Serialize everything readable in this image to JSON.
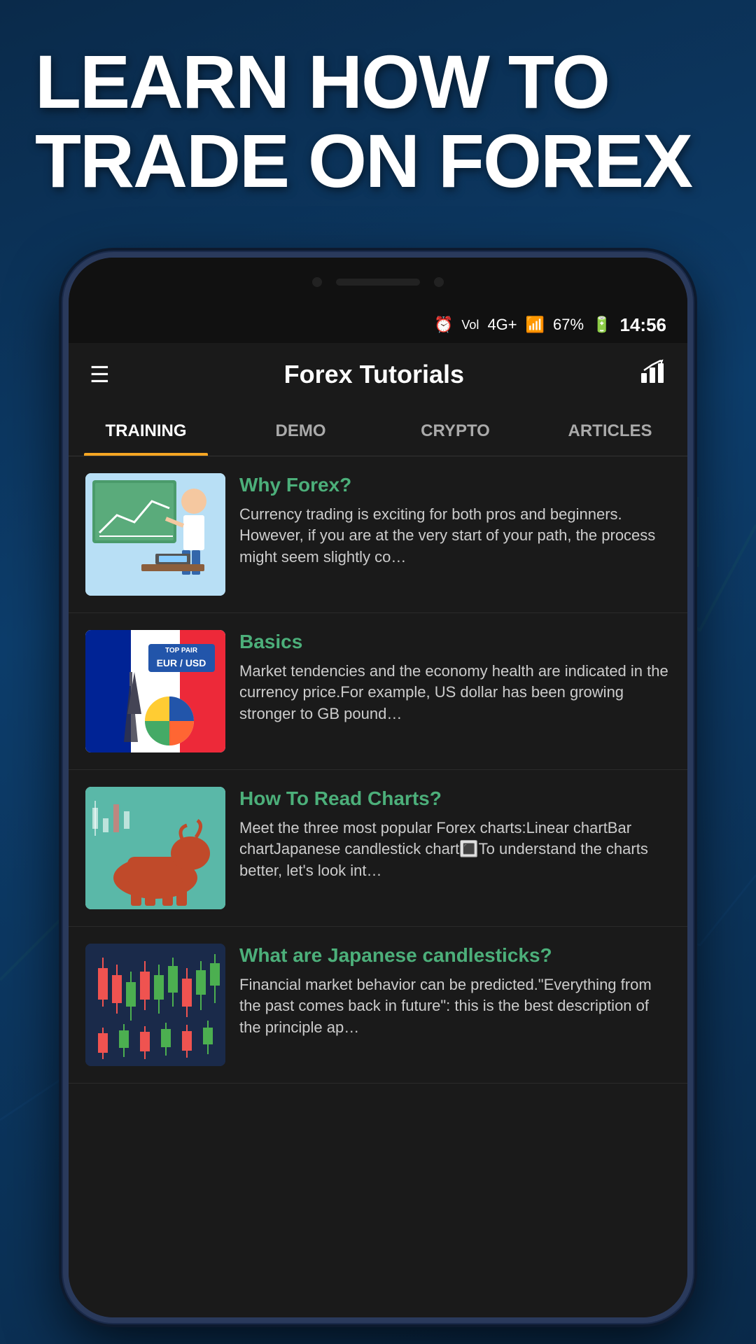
{
  "hero": {
    "title": "LEARN HOW TO TRADE ON FOREX"
  },
  "status_bar": {
    "time": "14:56",
    "battery": "67%",
    "signal": "4G+"
  },
  "app_bar": {
    "title": "Forex Tutorials",
    "menu_icon": "☰",
    "chart_icon": "📈"
  },
  "tabs": [
    {
      "label": "TRAINING",
      "active": true
    },
    {
      "label": "DEMO",
      "active": false
    },
    {
      "label": "CRYPTO",
      "active": false
    },
    {
      "label": "ARTICLES",
      "active": false
    }
  ],
  "articles": [
    {
      "title": "Why Forex?",
      "description": "Currency trading is exciting for both pros and beginners. However, if you are at the very start of your path, the process might seem slightly co…",
      "thumb_type": "why-forex"
    },
    {
      "title": "Basics",
      "description": "Market tendencies and the economy health are indicated in the currency price.For example, US dollar has been growing stronger to GB pound…",
      "thumb_type": "basics"
    },
    {
      "title": "How To Read Charts?",
      "description": "Meet the three most popular Forex charts:Linear chartBar chartJapanese candlestick chart🔳To understand the charts better, let's look int…",
      "thumb_type": "charts"
    },
    {
      "title": "What are Japanese candlesticks?",
      "description": "Financial market behavior can be predicted.\"Everything from the past comes back in future\": this is the best description of the principle ap…",
      "thumb_type": "japanese"
    }
  ],
  "colors": {
    "accent_green": "#4caf7a",
    "tab_active_underline": "#f5a623",
    "background_dark": "#1a1a1a",
    "text_primary": "#ffffff",
    "text_secondary": "#cccccc"
  }
}
